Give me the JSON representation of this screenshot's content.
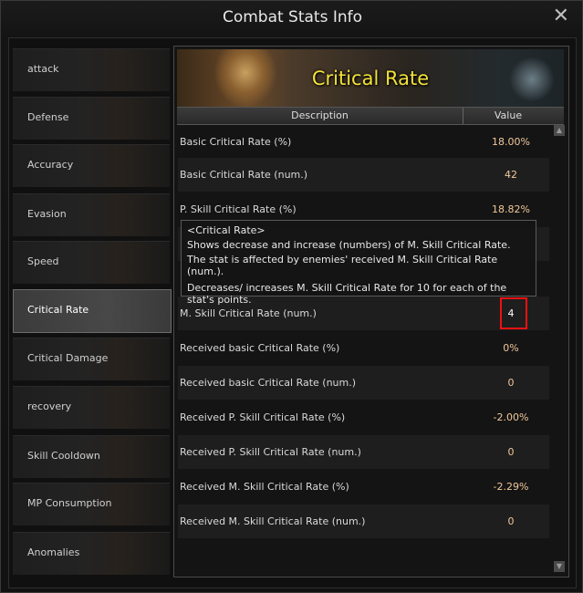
{
  "window": {
    "title": "Combat Stats Info",
    "close_glyph": "✕"
  },
  "sidebar": {
    "items": [
      {
        "label": "attack"
      },
      {
        "label": "Defense"
      },
      {
        "label": "Accuracy"
      },
      {
        "label": "Evasion"
      },
      {
        "label": "Speed"
      },
      {
        "label": "Critical Rate",
        "active": true
      },
      {
        "label": "Critical Damage"
      },
      {
        "label": "recovery"
      },
      {
        "label": "Skill Cooldown"
      },
      {
        "label": "MP Consumption"
      },
      {
        "label": "Anomalies"
      }
    ]
  },
  "panel": {
    "banner_title": "Critical Rate",
    "columns": {
      "description": "Description",
      "value": "Value"
    },
    "rows": [
      {
        "description": "Basic Critical Rate (%)",
        "value": "18.00%"
      },
      {
        "description": "Basic Critical Rate (num.)",
        "value": "42"
      },
      {
        "description": "P. Skill Critical Rate (%)",
        "value": "18.82%"
      },
      {
        "description": "",
        "value": ""
      },
      {
        "description": "",
        "value": ""
      },
      {
        "description": "M. Skill Critical Rate (num.)",
        "value": "4"
      },
      {
        "description": "Received basic Critical Rate (%)",
        "value": "0%"
      },
      {
        "description": "Received basic Critical Rate (num.)",
        "value": "0"
      },
      {
        "description": "Received P. Skill Critical Rate (%)",
        "value": "-2.00%"
      },
      {
        "description": "Received P. Skill Critical Rate (num.)",
        "value": "0"
      },
      {
        "description": "Received M. Skill Critical Rate (%)",
        "value": "-2.29%"
      },
      {
        "description": "Received M. Skill Critical Rate (num.)",
        "value": "0"
      }
    ]
  },
  "tooltip": {
    "title": "<Critical Rate>",
    "line1": "Shows decrease and increase (numbers) of M. Skill Critical Rate.",
    "line2": "The stat is affected by enemies' received M. Skill Critical Rate (num.).",
    "line3": "Decreases/ increases M. Skill Critical Rate for 10 for each of the stat's points."
  },
  "colors": {
    "banner_title": "#f2e23a",
    "value_text": "#f0c89a",
    "highlight": "#ee1111"
  }
}
